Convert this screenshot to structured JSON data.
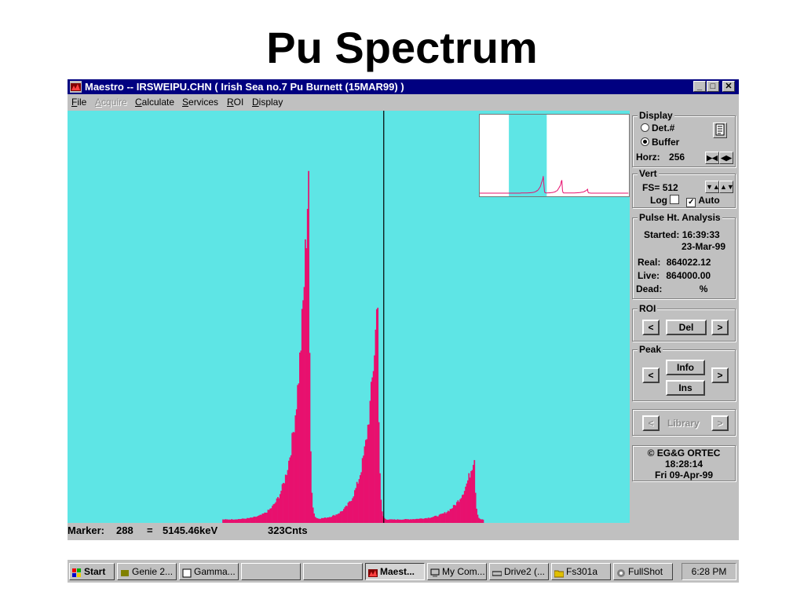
{
  "slide": {
    "title": "Pu Spectrum"
  },
  "window": {
    "title": "Maestro -- IRSWEIPU.CHN ( Irish Sea no.7 Pu Burnett (15MAR99) )",
    "buttons": {
      "minimize": "_",
      "maximize": "□",
      "close": "✕"
    }
  },
  "menu": [
    {
      "label": "File",
      "enabled": true
    },
    {
      "label": "Acquire",
      "enabled": false
    },
    {
      "label": "Calculate",
      "enabled": true
    },
    {
      "label": "Services",
      "enabled": true
    },
    {
      "label": "ROI",
      "enabled": true
    },
    {
      "label": "Display",
      "enabled": true
    }
  ],
  "colors": {
    "plot_bg": "#5ee5e5",
    "spectrum": "#e8106e",
    "marker": "#000000"
  },
  "chart_data": {
    "type": "bar",
    "x_unit": "channel",
    "xlim": [
      0,
      512
    ],
    "ylim": [
      0,
      512
    ],
    "marker_channel": 288,
    "peaks": [
      {
        "center": 219,
        "height": 440,
        "width": 10
      },
      {
        "center": 282,
        "height": 285,
        "width": 10
      },
      {
        "center": 370,
        "height": 80,
        "width": 12
      }
    ],
    "inset_window": [
      100,
      230
    ]
  },
  "status": {
    "marker_label": "Marker:",
    "marker_channel": "288",
    "equals": "=",
    "energy": "5145.46keV",
    "counts": "323Cnts"
  },
  "panel": {
    "display": {
      "title": "Display",
      "det_label": "Det.#",
      "buffer_label": "Buffer",
      "selected": "Buffer",
      "horz_label": "Horz:",
      "horz_value": "256"
    },
    "vert": {
      "title": "Vert",
      "fs_label": "FS=",
      "fs_value": "512",
      "log_label": "Log",
      "auto_label": "Auto",
      "log_checked": false,
      "auto_checked": true
    },
    "pha": {
      "title": "Pulse Ht. Analysis",
      "started_label": "Started:",
      "started_time": "16:39:33",
      "started_date": "23-Mar-99",
      "real_label": "Real:",
      "real_value": "864022.12",
      "live_label": "Live:",
      "live_value": "864000.00",
      "dead_label": "Dead:",
      "dead_value": "%"
    },
    "roi": {
      "title": "ROI",
      "prev": "<",
      "del": "Del",
      "next": ">"
    },
    "peak": {
      "title": "Peak",
      "prev": "<",
      "info": "Info",
      "ins": "Ins",
      "next": ">"
    },
    "library": {
      "prev": "<",
      "label": "Library",
      "next": ">"
    },
    "clock": {
      "brand": "© EG&G ORTEC",
      "time": "18:28:14",
      "date": "Fri  09-Apr-99"
    }
  },
  "taskbar": {
    "start": "Start",
    "items": [
      {
        "label": "Genie 2...",
        "active": false
      },
      {
        "label": "Gamma...",
        "active": false
      },
      {
        "label": "",
        "active": false
      },
      {
        "label": "",
        "active": false
      },
      {
        "label": "Maest...",
        "active": true
      },
      {
        "label": "My Com...",
        "active": false
      },
      {
        "label": "Drive2 (...",
        "active": false
      },
      {
        "label": "Fs301a",
        "active": false
      },
      {
        "label": "FullShot",
        "active": false
      }
    ],
    "clock": "6:28 PM"
  }
}
